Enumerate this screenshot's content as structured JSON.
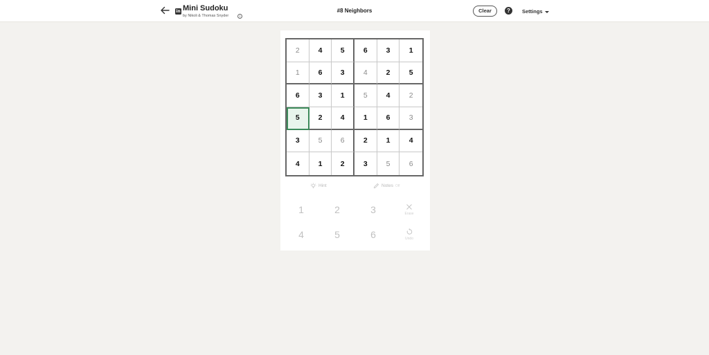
{
  "header": {
    "back_icon": "arrow-left-icon",
    "logo_text": "in",
    "app_title": "Mini Sudoku",
    "byline": "by Nikoli & Thomas Snyder",
    "info_glyph": "i",
    "puzzle_title": "#8 Neighbors",
    "clear_label": "Clear",
    "help_glyph": "?",
    "settings_label": "Settings"
  },
  "board": {
    "selected": [
      3,
      0
    ],
    "accent_color": "#3c8a5a",
    "rows": [
      [
        {
          "v": "2",
          "given": false
        },
        {
          "v": "4",
          "given": true
        },
        {
          "v": "5",
          "given": true
        },
        {
          "v": "6",
          "given": true
        },
        {
          "v": "3",
          "given": true
        },
        {
          "v": "1",
          "given": true
        }
      ],
      [
        {
          "v": "1",
          "given": false
        },
        {
          "v": "6",
          "given": true
        },
        {
          "v": "3",
          "given": true
        },
        {
          "v": "4",
          "given": false
        },
        {
          "v": "2",
          "given": true
        },
        {
          "v": "5",
          "given": true
        }
      ],
      [
        {
          "v": "6",
          "given": true
        },
        {
          "v": "3",
          "given": true
        },
        {
          "v": "1",
          "given": true
        },
        {
          "v": "5",
          "given": false
        },
        {
          "v": "4",
          "given": true
        },
        {
          "v": "2",
          "given": false
        }
      ],
      [
        {
          "v": "5",
          "given": true
        },
        {
          "v": "2",
          "given": true
        },
        {
          "v": "4",
          "given": true
        },
        {
          "v": "1",
          "given": true
        },
        {
          "v": "6",
          "given": true
        },
        {
          "v": "3",
          "given": false
        }
      ],
      [
        {
          "v": "3",
          "given": true
        },
        {
          "v": "5",
          "given": false
        },
        {
          "v": "6",
          "given": false
        },
        {
          "v": "2",
          "given": true
        },
        {
          "v": "1",
          "given": true
        },
        {
          "v": "4",
          "given": true
        }
      ],
      [
        {
          "v": "4",
          "given": true
        },
        {
          "v": "1",
          "given": true
        },
        {
          "v": "2",
          "given": true
        },
        {
          "v": "3",
          "given": true
        },
        {
          "v": "5",
          "given": false
        },
        {
          "v": "6",
          "given": false
        }
      ]
    ]
  },
  "tools": {
    "hint_label": "Hint",
    "hint_icon": "lightbulb-icon",
    "notes_label": "Notes",
    "notes_state": "Off",
    "notes_icon": "pencil-icon"
  },
  "keypad": {
    "digits": [
      "1",
      "2",
      "3",
      "4",
      "5",
      "6"
    ],
    "erase_label": "Erase",
    "erase_icon": "x-icon",
    "undo_label": "Undo",
    "undo_icon": "undo-icon"
  }
}
